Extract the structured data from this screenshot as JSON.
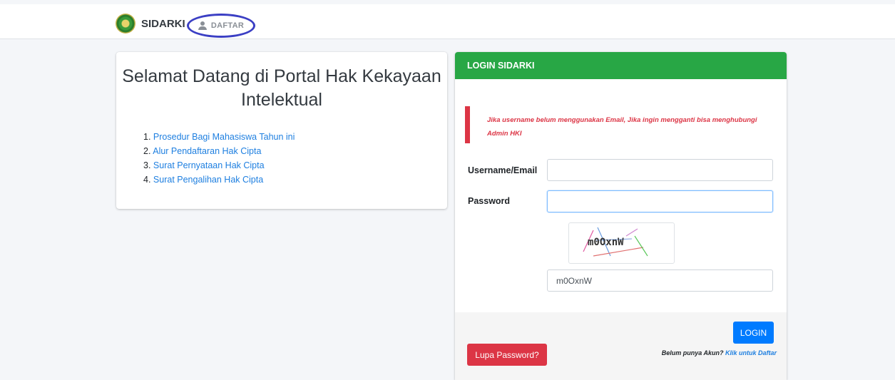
{
  "navbar": {
    "brand": "SIDARKI",
    "daftar": "DAFTAR"
  },
  "welcome": {
    "title": "Selamat Datang di Portal Hak Kekayaan Intelektual",
    "links": [
      {
        "num": "1.",
        "label": "Prosedur Bagi Mahasiswa Tahun ini"
      },
      {
        "num": "2.",
        "label": "Alur Pendaftaran Hak Cipta"
      },
      {
        "num": "3.",
        "label": "Surat Pernyataan Hak Cipta"
      },
      {
        "num": "4.",
        "label": "Surat Pengalihan Hak Cipta"
      }
    ]
  },
  "login": {
    "header": "LOGIN SIDARKI",
    "notice": "Jika username belum menggunakan Email, Jika ingin mengganti bisa menghubungi Admin HKI",
    "username_label": "Username/Email",
    "username_value": "",
    "password_label": "Password",
    "password_value": "",
    "captcha_text": "m0OxnW",
    "captcha_value": "m0OxnW",
    "login_button": "LOGIN",
    "lupa_button": "Lupa Password?",
    "signup_prefix": "Belum punya Akun?",
    "signup_link": "Klik untuk Daftar"
  },
  "colors": {
    "header": "#28a745",
    "primary": "#007bff",
    "danger": "#dc3545",
    "highlight_circle": "#3b3fc4"
  }
}
